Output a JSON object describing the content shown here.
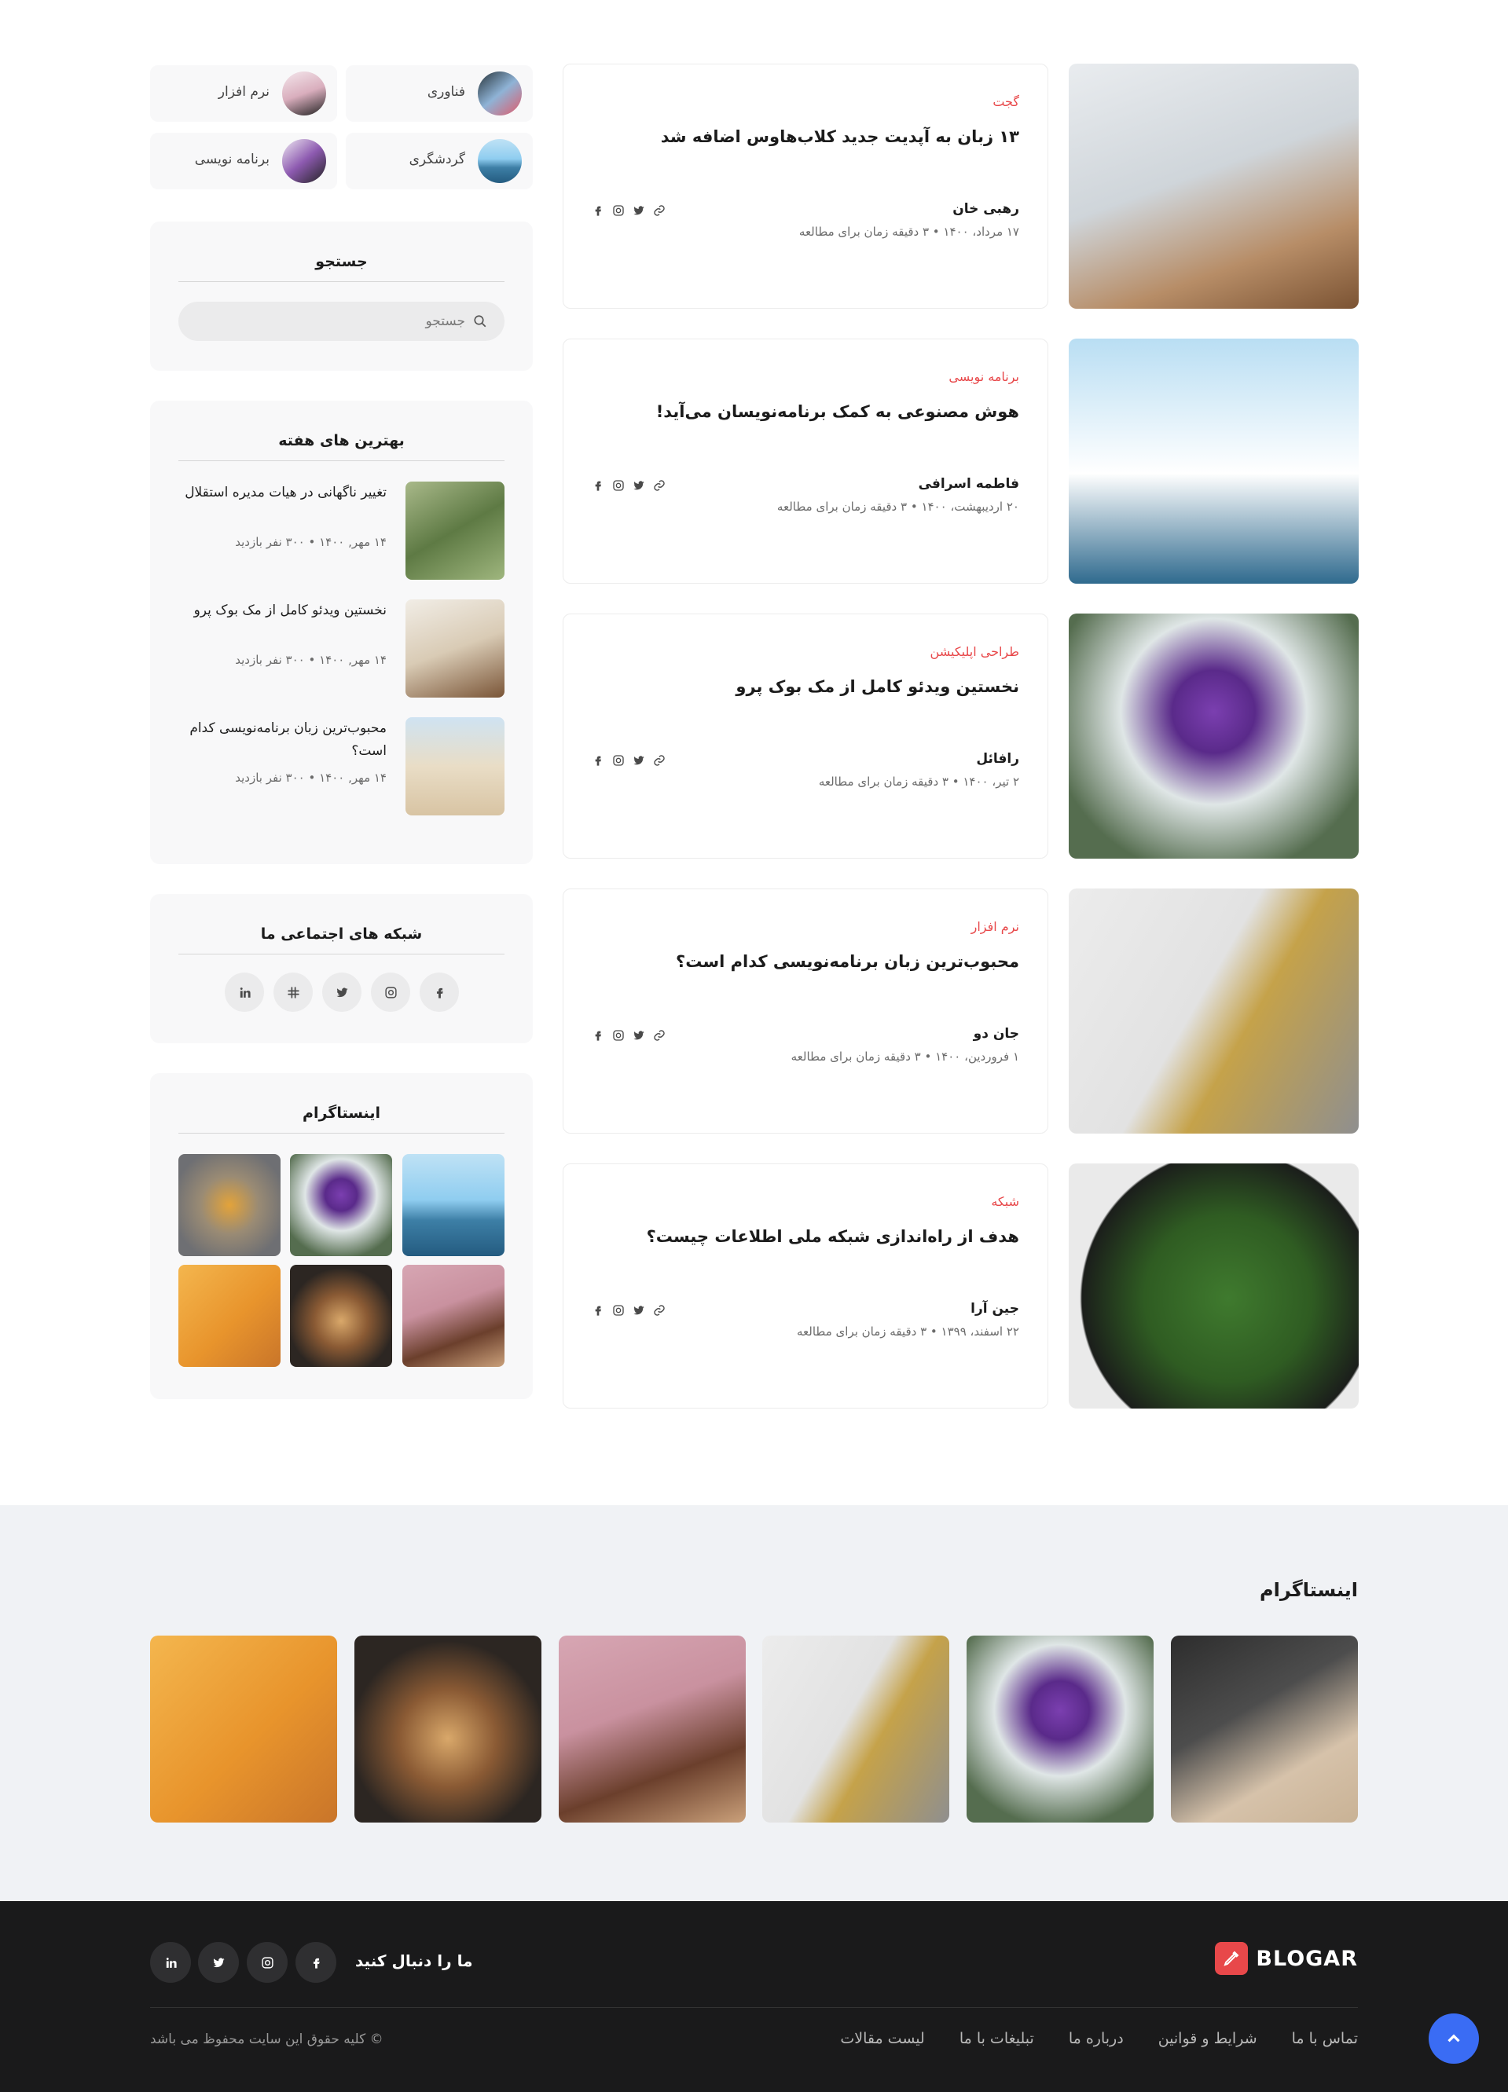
{
  "categories": [
    {
      "label": "فناوری"
    },
    {
      "label": "نرم افزار"
    },
    {
      "label": "گردشگری"
    },
    {
      "label": "برنامه نویسی"
    }
  ],
  "search": {
    "title": "جستجو",
    "placeholder": "جستجو"
  },
  "best": {
    "title": "بهترین های هفته",
    "items": [
      {
        "title": "تغییر ناگهانی در هیات مدیره استقلال",
        "meta": "۱۴ مهر, ۱۴۰۰ • ۳۰۰ نفر بازدید"
      },
      {
        "title": "نخستین ویدئو کامل از مک بوک پرو",
        "meta": "۱۴ مهر, ۱۴۰۰ • ۳۰۰ نفر بازدید"
      },
      {
        "title": "محبوب‌ترین زبان برنامه‌نویسی کدام است؟",
        "meta": "۱۴ مهر, ۱۴۰۰ • ۳۰۰ نفر بازدید"
      }
    ]
  },
  "social_box": {
    "title": "شبکه های اجتماعی ما"
  },
  "instagram_box": {
    "title": "اینستاگرام"
  },
  "posts": [
    {
      "category": "گجت",
      "title": "۱۳ زبان به آپدیت جدید کلاب‌هاوس اضافه شد",
      "author": "رهبی خان",
      "meta": "۱۷ مرداد، ۱۴۰۰ • ۳ دقیقه زمان برای مطالعه"
    },
    {
      "category": "برنامه نویسی",
      "title": "هوش مصنوعی به کمک برنامه‌نویسان می‌آید!",
      "author": "فاطمه اسرافی",
      "meta": "۲۰ اردیبهشت، ۱۴۰۰ • ۳ دقیقه زمان برای مطالعه"
    },
    {
      "category": "طراحی اپلیکیشن",
      "title": "نخستین ویدئو کامل از مک بوک پرو",
      "author": "رافائل",
      "meta": "۲ تیر، ۱۴۰۰ • ۳ دقیقه زمان برای مطالعه"
    },
    {
      "category": "نرم افزار",
      "title": "محبوب‌ترین زبان برنامه‌نویسی کدام است؟",
      "author": "جان دو",
      "meta": "۱ فروردین، ۱۴۰۰ • ۳ دقیقه زمان برای مطالعه"
    },
    {
      "category": "شبکه",
      "title": "هدف از راه‌اندازی شبکه ملی اطلاعات چیست؟",
      "author": "جین آرا",
      "meta": "۲۲ اسفند، ۱۳۹۹ • ۳ دقیقه زمان برای مطالعه"
    }
  ],
  "instagram_section": {
    "title": "اینستاگرام"
  },
  "footer": {
    "brand": "BLOGAR",
    "follow_label": "ما را دنبال کنید",
    "links": [
      "تماس با ما",
      "شرایط و قوانین",
      "درباره ما",
      "تبلیغات با ما",
      "لیست مقالات"
    ],
    "copyright": "© کلیه حقوق این سایت محفوظ می باشد"
  },
  "colors": {
    "accent": "#e8484a",
    "scroll_button": "#3a6cf4",
    "footer_bg": "#1a1a1b"
  }
}
